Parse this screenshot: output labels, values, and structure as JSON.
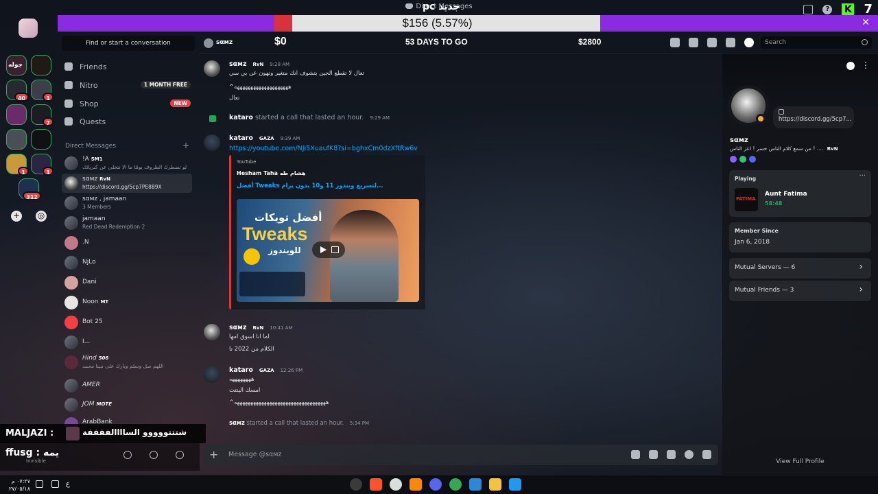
{
  "window": {
    "title": "Direct Messages",
    "kick_viewers": "7"
  },
  "stream_goal": {
    "current": "$156 (5.57%)",
    "min": "$0",
    "max": "$2800",
    "days_left": "53 DAYS TO GO",
    "pc_label": "pc جديد",
    "progress_fraction": 0.0557
  },
  "servers": {
    "items": [
      {
        "label": "جوله",
        "badge": ""
      },
      {
        "label": "",
        "badge": ""
      },
      {
        "label": "",
        "badge": "40"
      },
      {
        "label": "",
        "badge": "1"
      },
      {
        "label": "",
        "badge": ""
      },
      {
        "label": "",
        "badge": "7"
      },
      {
        "label": "",
        "badge": ""
      },
      {
        "label": "",
        "badge": ""
      },
      {
        "label": "",
        "badge": "1"
      },
      {
        "label": "",
        "badge": "1"
      },
      {
        "label": "",
        "badge": "312"
      }
    ]
  },
  "sidebar": {
    "find_placeholder": "Find or start a conversation",
    "nav": [
      {
        "label": "Friends",
        "badge": ""
      },
      {
        "label": "Nitro",
        "badge": "1 MONTH FREE"
      },
      {
        "label": "Shop",
        "badge": "NEW"
      },
      {
        "label": "Quests",
        "badge": ""
      }
    ],
    "dm_header": "Direct Messages",
    "dms": [
      {
        "name": "!A",
        "tag": "SM1",
        "sub": "لو تضطرك الظروف يومًا ما الا تتخلى عن كبريائك"
      },
      {
        "name": "sαмz",
        "tag": "RvN",
        "sub": "https://discord.gg/5cp7PE889X"
      },
      {
        "name": "sαмz , jamaan",
        "tag": "",
        "sub": "3 Members"
      },
      {
        "name": "jamaan",
        "tag": "",
        "sub": "Red Dead Redemption 2"
      },
      {
        "name": ".N",
        "tag": "",
        "sub": ""
      },
      {
        "name": "NjLo",
        "tag": "",
        "sub": ""
      },
      {
        "name": "Dani",
        "tag": "",
        "sub": ""
      },
      {
        "name": "Noon",
        "tag": "MT",
        "sub": ""
      },
      {
        "name": "Bot 25",
        "tag": "",
        "sub": ""
      },
      {
        "name": "I...",
        "tag": "",
        "sub": ""
      },
      {
        "name": "Hind",
        "tag": "506",
        "sub": "اللهم صل وسلم وبارك على نبينا محمد"
      },
      {
        "name": "AMER",
        "tag": "",
        "sub": ""
      },
      {
        "name": "JOM",
        "tag": "MOTE",
        "sub": ""
      },
      {
        "name": "ArabBank",
        "tag": "",
        "sub": ""
      }
    ]
  },
  "stream_chat": {
    "user": "MALJAZI :",
    "message": "شتتتووووو الساااالففففة"
  },
  "user_panel": {
    "name": "ffusg : يمه",
    "status": "Invisible"
  },
  "chat": {
    "recipient": "sαмz",
    "search_placeholder": "Search",
    "composer_placeholder": "Message @sαмz",
    "messages": [
      {
        "author": "sαмz",
        "tag": "RvN",
        "time": "9:28 AM",
        "lines": [
          "تعال لا تقطع الجين بتشوف انك متغير وتهون عن بي سي",
          "^ههههههههههههههههههههه",
          "تعال"
        ]
      },
      {
        "call": "kataro started a call that lasted an hour.",
        "caller": "kataro",
        "text": "started a call that lasted an hour.",
        "time": "9:29 AM"
      },
      {
        "author": "kataro",
        "tag": "GAZA",
        "time": "9:39 AM",
        "link": "https://youtube.com/NJi5XuaufK8?si=bghxCm0dzXftRw6v",
        "embed": {
          "provider": "YouTube",
          "author": "Hesham Taha هشام طه",
          "title": "أفضل Tweaks لتسريع ويندوز 11 و10 بدون برام...",
          "thumb_t1": "أفضل تويكات",
          "thumb_t2": "Tweaks",
          "thumb_t3": "للويندوز"
        }
      },
      {
        "author": "sαмz",
        "tag": "RvN",
        "time": "10:41 AM",
        "lines": [
          "اما انا اسوق امها",
          "الكلام من 2022 تا"
        ]
      },
      {
        "author": "kataro",
        "tag": "GAZA",
        "time": "12:26 PM",
        "lines": [
          "ههههههههه",
          "امسك اليتتت",
          "^ههههههههههههههههههههههههههههههههههه"
        ]
      },
      {
        "caller": "sαмz",
        "text": "started a call that lasted an hour.",
        "time": "5:34 PM"
      }
    ]
  },
  "profile": {
    "name": "sαмz",
    "bio": "من سمع كلام الناس خسر ! اعز الناس ! ....",
    "bio_tag": "RvN",
    "custom_status": "https://discord.gg/5cp7...",
    "playing_label": "Playing",
    "game": "Aunt Fatima",
    "game_art": "FATIMA",
    "game_time": "58:48",
    "member_since_label": "Member Since",
    "member_since": "Jan 6, 2018",
    "mutual_servers": "Mutual Servers — 6",
    "mutual_friends": "Mutual Friends — 3",
    "view_full": "View Full Profile"
  },
  "taskbar": {
    "time": "٠٧:٢٧ م",
    "date": "٢٧/٠٥/١٨",
    "lang": "ع"
  },
  "colors": {
    "goal_bar": "#8a2be2",
    "accent_link": "#00a8fc",
    "online": "#23a55a",
    "embed_bar": "#d63a3a"
  }
}
